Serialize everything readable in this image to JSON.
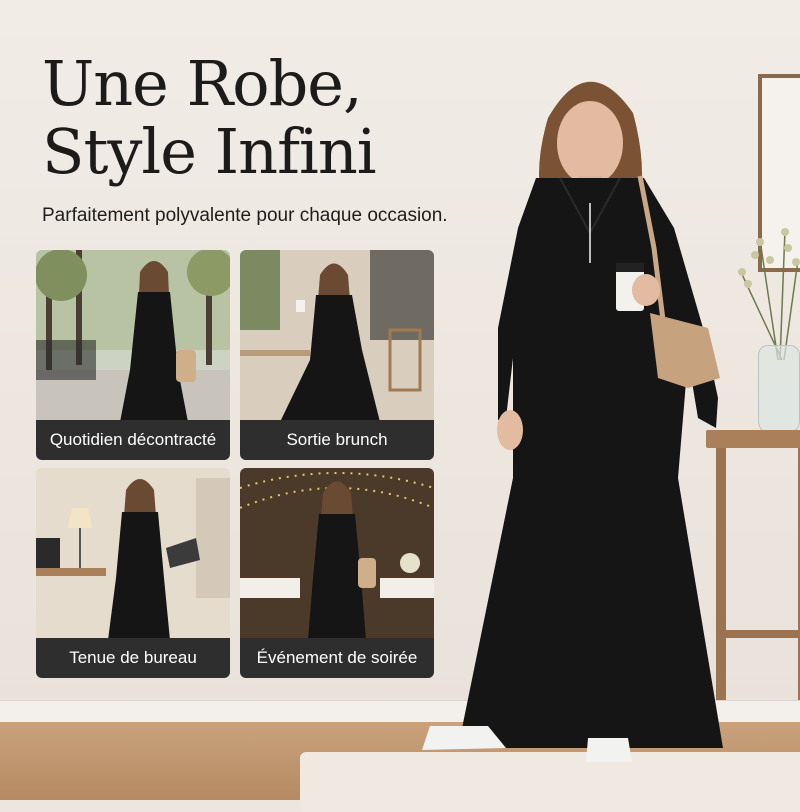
{
  "headline": {
    "line1": "Une Robe,",
    "line2": "Style Infini"
  },
  "subtitle": "Parfaitement polyvalente pour chaque occasion.",
  "occasions": [
    {
      "label": "Quotidien décontracté",
      "scene": "street-park"
    },
    {
      "label": "Sortie brunch",
      "scene": "cafe-terrace"
    },
    {
      "label": "Tenue de bureau",
      "scene": "home-office"
    },
    {
      "label": "Événement de soirée",
      "scene": "evening-party"
    }
  ],
  "colors": {
    "dress": "#151515",
    "label_bg": "#2e2e2e",
    "wall": "#eee8e1",
    "floor": "#b98e66"
  }
}
